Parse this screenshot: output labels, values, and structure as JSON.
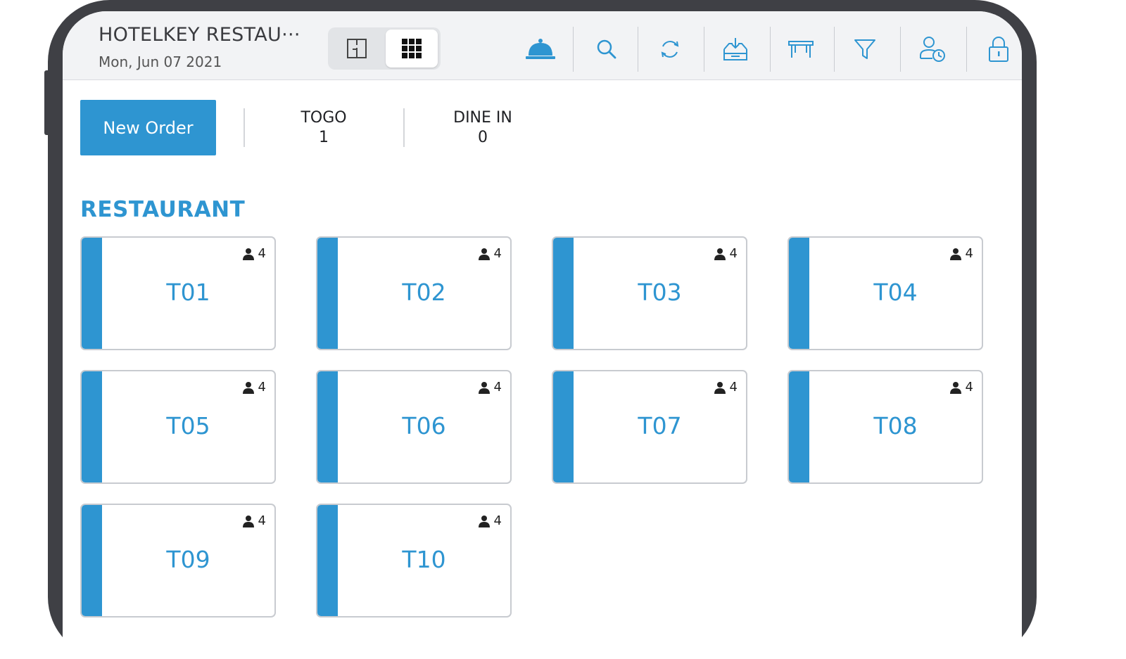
{
  "header": {
    "title": "HOTELKEY RESTAU···",
    "date": "Mon, Jun 07 2021",
    "view_toggle": [
      "floor-plan-view",
      "grid-view"
    ],
    "toolbar_icons": [
      "service-bell-icon",
      "search-icon",
      "refresh-icon",
      "cash-drawer-icon",
      "table-icon",
      "filter-icon",
      "user-clock-icon",
      "lock-icon"
    ]
  },
  "orders": {
    "new_order_label": "New Order",
    "togo_label": "TOGO",
    "togo_count": "1",
    "dinein_label": "DINE IN",
    "dinein_count": "0"
  },
  "section": {
    "title": "RESTAURANT",
    "tables": [
      {
        "name": "T01",
        "guests": "4"
      },
      {
        "name": "T02",
        "guests": "4"
      },
      {
        "name": "T03",
        "guests": "4"
      },
      {
        "name": "T04",
        "guests": "4"
      },
      {
        "name": "T05",
        "guests": "4"
      },
      {
        "name": "T06",
        "guests": "4"
      },
      {
        "name": "T07",
        "guests": "4"
      },
      {
        "name": "T08",
        "guests": "4"
      },
      {
        "name": "T09",
        "guests": "4"
      },
      {
        "name": "T10",
        "guests": "4"
      }
    ]
  },
  "colors": {
    "accent": "#2e95d1",
    "frame": "#3f4045",
    "topbar": "#f2f3f5"
  }
}
